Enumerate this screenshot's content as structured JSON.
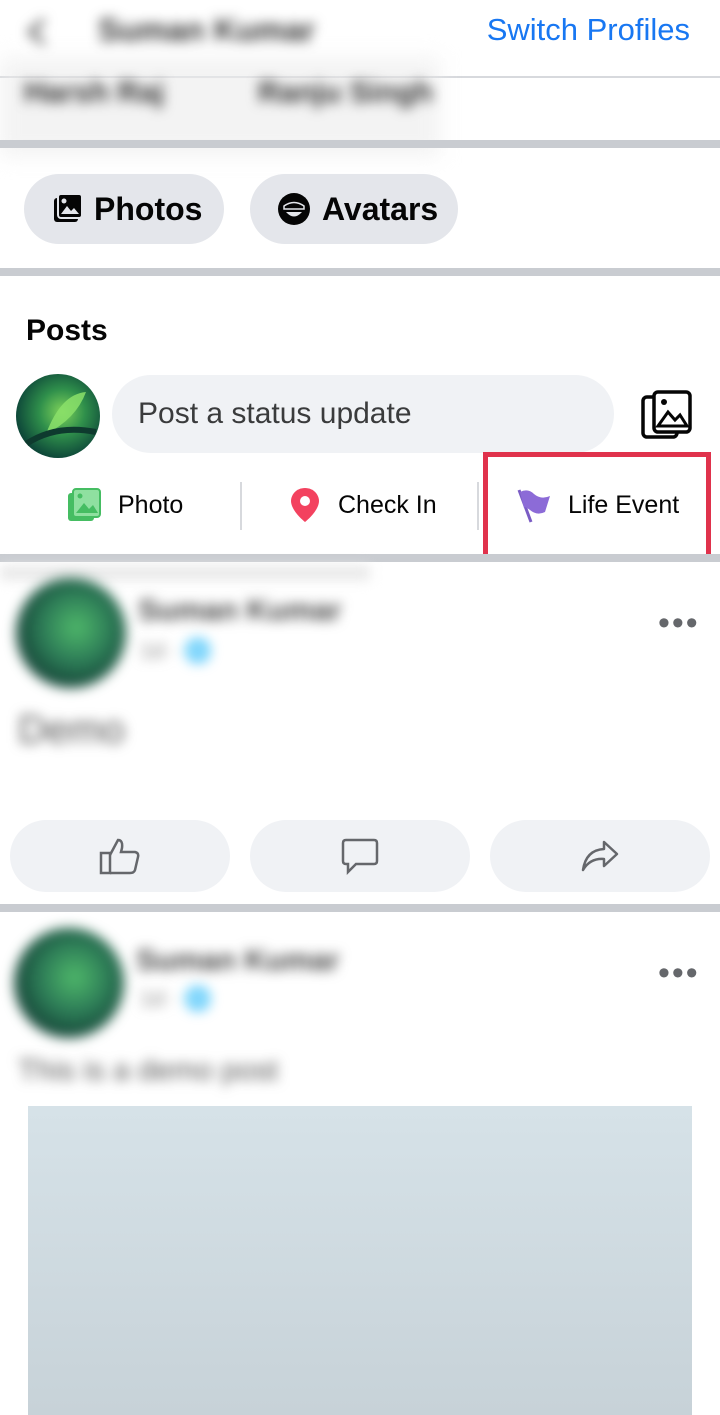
{
  "header": {
    "profile_name": "Suman Kumar",
    "switch_profiles": "Switch Profiles",
    "friends": [
      "Harsh Raj",
      "Ranju Singh"
    ]
  },
  "chips": {
    "photos": "Photos",
    "avatars": "Avatars"
  },
  "posts": {
    "title": "Posts",
    "status_placeholder": "Post a status update",
    "actions": {
      "photo": "Photo",
      "check_in": "Check In",
      "life_event": "Life Event"
    }
  },
  "feed": [
    {
      "author": "Suman Kumar",
      "meta": "1d · 🌐",
      "text": "Demo",
      "more": "•••"
    },
    {
      "author": "Suman Kumar",
      "meta": "1d · 🌐",
      "text": "This is a demo post",
      "more": "•••"
    }
  ],
  "colors": {
    "accent": "#1877f2",
    "highlight": "#e0324c",
    "photo_icon": "#45bd62",
    "checkin_icon": "#f3425f",
    "life_event_icon": "#8c6bd7"
  }
}
